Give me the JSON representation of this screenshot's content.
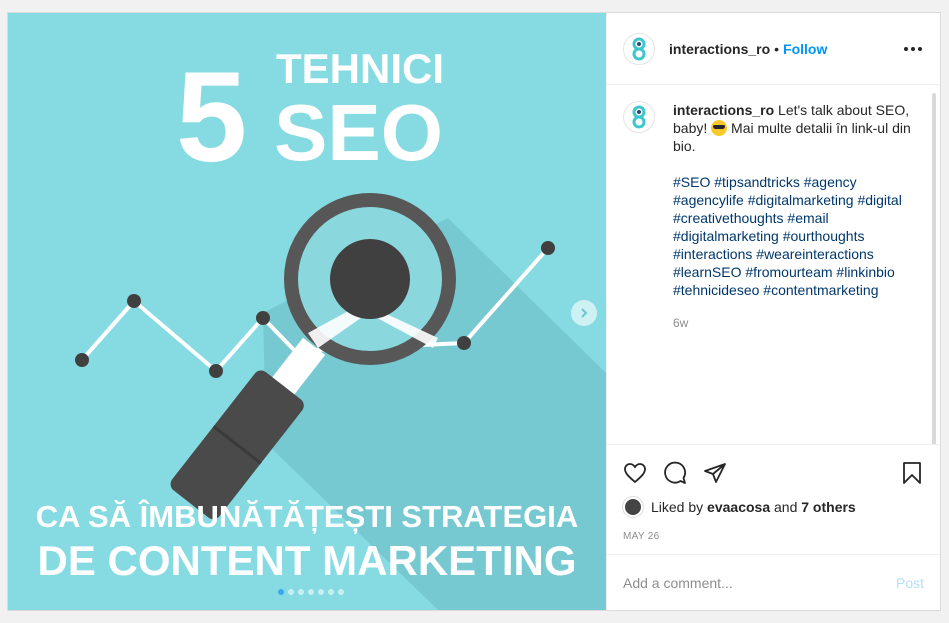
{
  "post_image": {
    "title_number": "5",
    "title_word1": "TEHNICI",
    "title_word2": "SEO",
    "subtitle_line1": "CA SĂ ÎMBUNĂTĂȚEȘTI STRATEGIA",
    "subtitle_line2": "DE CONTENT MARKETING",
    "background_color": "#86dbe2",
    "carousel_count": 7,
    "carousel_active": 1
  },
  "header": {
    "username": "interactions_ro",
    "separator": "•",
    "follow_label": "Follow"
  },
  "caption": {
    "username": "interactions_ro",
    "text_before_emoji": "Let's talk about SEO, baby!",
    "emoji": "sunglasses-emoji",
    "text_after_emoji": "Mai multe detalii în link-ul din bio.",
    "hashtags": [
      "#SEO",
      "#tipsandtricks",
      "#agency",
      "#agencylife",
      "#digitalmarketing",
      "#digital",
      "#creativethoughts",
      "#email",
      "#digitalmarketing",
      "#ourthoughts",
      "#interactions",
      "#weareinteractions",
      "#learnSEO",
      "#fromourteam",
      "#linkinbio",
      "#tehnicideseo",
      "#contentmarketing"
    ],
    "age": "6w"
  },
  "likes": {
    "prefix": "Liked by",
    "user": "evaacosa",
    "middle": "and",
    "others": "7 others"
  },
  "date": "MAY 26",
  "comment": {
    "placeholder": "Add a comment...",
    "post_label": "Post"
  },
  "colors": {
    "link": "#00376b",
    "follow": "#0095f6",
    "post_disabled": "#b2dffc"
  }
}
